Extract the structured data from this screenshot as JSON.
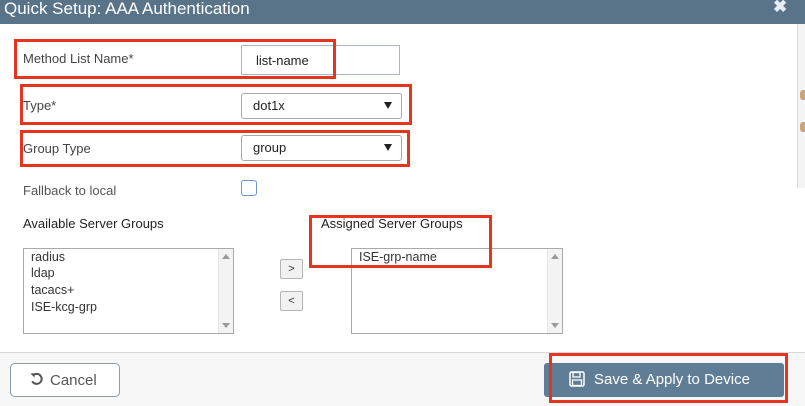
{
  "dialog": {
    "title": "Quick Setup: AAA Authentication",
    "close_symbol": "✖"
  },
  "form": {
    "method_list_name": {
      "label": "Method List Name*",
      "value": "list-name"
    },
    "type": {
      "label": "Type*",
      "value": "dot1x"
    },
    "group_type": {
      "label": "Group Type",
      "value": "group"
    },
    "fallback": {
      "label": "Fallback to local",
      "checked": false
    }
  },
  "server_groups": {
    "available": {
      "label": "Available Server Groups",
      "items": [
        "radius",
        "ldap",
        "tacacs+",
        "ISE-kcg-grp"
      ]
    },
    "assigned": {
      "label": "Assigned Server Groups",
      "items": [
        "ISE-grp-name"
      ]
    },
    "move_right_symbol": ">",
    "move_left_symbol": "<"
  },
  "footer": {
    "cancel_label": "Cancel",
    "save_label": "Save & Apply to Device",
    "cancel_icon": "undo-icon",
    "save_icon": "floppy-disk-icon"
  },
  "colors": {
    "titlebar": "#597389",
    "save_button": "#5f7e96",
    "highlight": "#e6341f",
    "checkbox_border": "#6f95c7"
  }
}
